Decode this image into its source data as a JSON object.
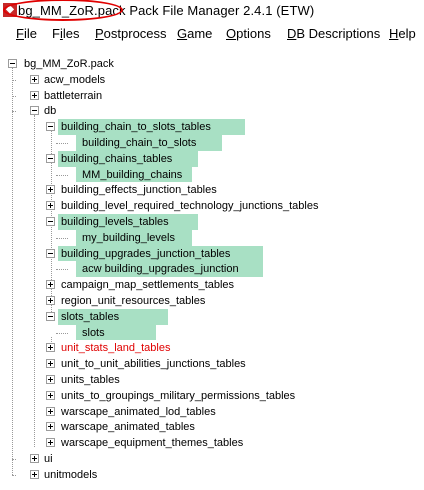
{
  "window": {
    "title_pack": "bg_MM_ZoR.pack",
    "title_app": "Pack File Manager 2.4.1 (ETW)"
  },
  "menu": {
    "items": [
      "File",
      "Files",
      "Postprocess",
      "Game",
      "Options",
      "DB Descriptions",
      "Help"
    ],
    "mnemonics": [
      "F",
      "i",
      "P",
      "G",
      "O",
      "D",
      "H"
    ]
  },
  "tree": {
    "root": "bg_MM_ZoR.pack",
    "nodes": [
      {
        "label": "acw_models",
        "level": 1,
        "expander": "+",
        "highlight": false,
        "red": false
      },
      {
        "label": "battleterrain",
        "level": 1,
        "expander": "+",
        "highlight": false,
        "red": false
      },
      {
        "label": "db",
        "level": 1,
        "expander": "-",
        "highlight": false,
        "red": false
      },
      {
        "label": "building_chain_to_slots_tables",
        "level": 2,
        "expander": "-",
        "highlight": true,
        "red": false
      },
      {
        "label": "building_chain_to_slots",
        "level": 3,
        "expander": "",
        "highlight": true,
        "red": false
      },
      {
        "label": "building_chains_tables",
        "level": 2,
        "expander": "-",
        "highlight": true,
        "red": false
      },
      {
        "label": "MM_building_chains",
        "level": 3,
        "expander": "",
        "highlight": true,
        "red": false
      },
      {
        "label": "building_effects_junction_tables",
        "level": 2,
        "expander": "+",
        "highlight": false,
        "red": false
      },
      {
        "label": "building_level_required_technology_junctions_tables",
        "level": 2,
        "expander": "+",
        "highlight": false,
        "red": false
      },
      {
        "label": "building_levels_tables",
        "level": 2,
        "expander": "-",
        "highlight": true,
        "red": false
      },
      {
        "label": "my_building_levels",
        "level": 3,
        "expander": "",
        "highlight": true,
        "red": false
      },
      {
        "label": "building_upgrades_junction_tables",
        "level": 2,
        "expander": "-",
        "highlight": true,
        "red": false
      },
      {
        "label": "acw building_upgrades_junction",
        "level": 3,
        "expander": "",
        "highlight": true,
        "red": false
      },
      {
        "label": "campaign_map_settlements_tables",
        "level": 2,
        "expander": "+",
        "highlight": false,
        "red": false
      },
      {
        "label": "region_unit_resources_tables",
        "level": 2,
        "expander": "+",
        "highlight": false,
        "red": false
      },
      {
        "label": "slots_tables",
        "level": 2,
        "expander": "-",
        "highlight": true,
        "red": false
      },
      {
        "label": "slots",
        "level": 3,
        "expander": "",
        "highlight": true,
        "red": false
      },
      {
        "label": "unit_stats_land_tables",
        "level": 2,
        "expander": "+",
        "highlight": false,
        "red": true
      },
      {
        "label": "unit_to_unit_abilities_junctions_tables",
        "level": 2,
        "expander": "+",
        "highlight": false,
        "red": false
      },
      {
        "label": "units_tables",
        "level": 2,
        "expander": "+",
        "highlight": false,
        "red": false
      },
      {
        "label": "units_to_groupings_military_permissions_tables",
        "level": 2,
        "expander": "+",
        "highlight": false,
        "red": false
      },
      {
        "label": "warscape_animated_lod_tables",
        "level": 2,
        "expander": "+",
        "highlight": false,
        "red": false
      },
      {
        "label": "warscape_animated_tables",
        "level": 2,
        "expander": "+",
        "highlight": false,
        "red": false
      },
      {
        "label": "warscape_equipment_themes_tables",
        "level": 2,
        "expander": "+",
        "highlight": false,
        "red": false
      },
      {
        "label": "ui",
        "level": 1,
        "expander": "+",
        "highlight": false,
        "red": false
      },
      {
        "label": "unitmodels",
        "level": 1,
        "expander": "+",
        "highlight": false,
        "red": false
      }
    ]
  },
  "colors": {
    "highlight": "#a8e0c4",
    "error_text": "#e00000",
    "annotation_ring": "#e00000"
  }
}
